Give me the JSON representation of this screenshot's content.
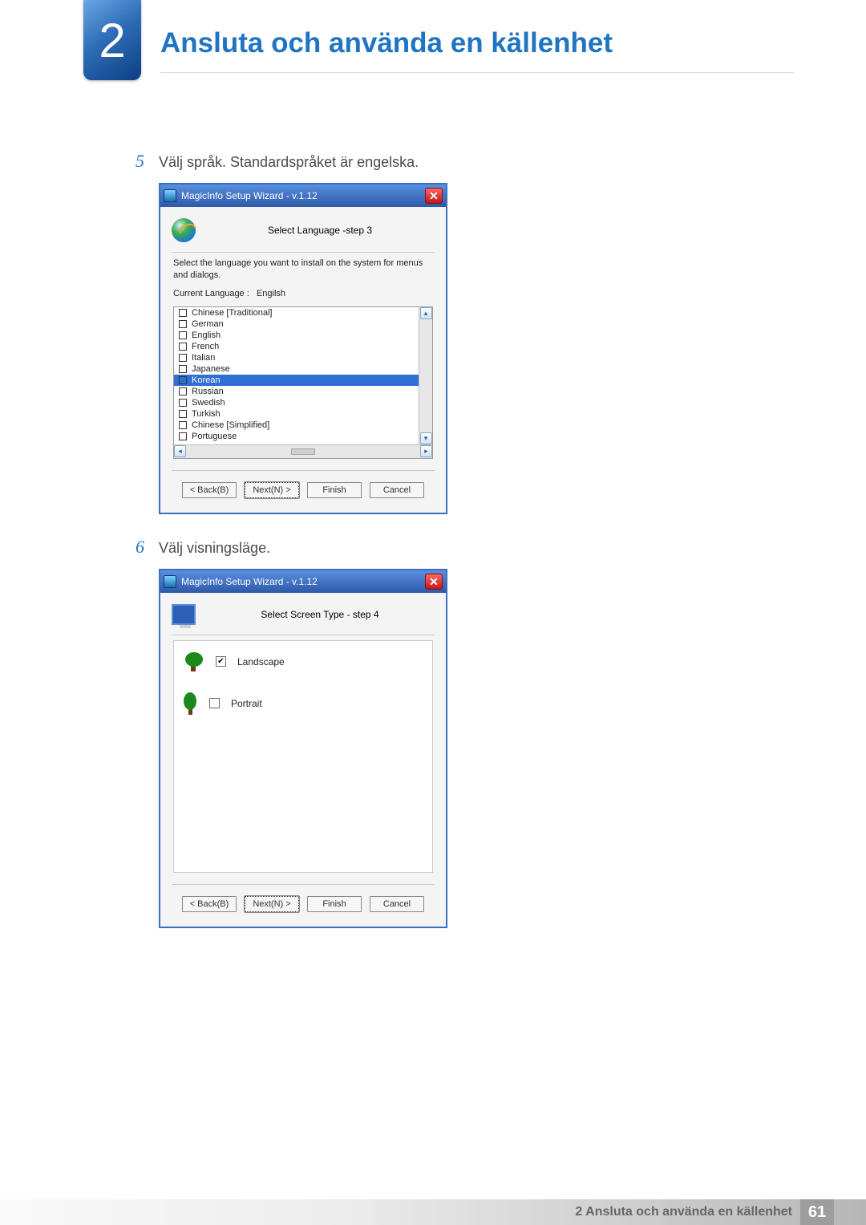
{
  "chapter": {
    "number": "2",
    "title": "Ansluta och använda en källenhet"
  },
  "steps": {
    "s5": {
      "num": "5",
      "text": "Välj språk. Standardspråket är engelska."
    },
    "s6": {
      "num": "6",
      "text": "Välj visningsläge."
    }
  },
  "dialog1": {
    "title": "MagicInfo Setup Wizard - v.1.12",
    "panel_title": "Select Language -step 3",
    "instruction": "Select the language you want to install on the system for menus and dialogs.",
    "current_lang_label": "Current Language    :",
    "current_lang_value": "Engilsh",
    "languages": [
      "Chinese [Traditional]",
      "German",
      "English",
      "French",
      "Italian",
      "Japanese",
      "Korean",
      "Russian",
      "Swedish",
      "Turkish",
      "Chinese [Simplified]",
      "Portuguese"
    ],
    "selected_index": 6,
    "buttons": {
      "back": "< Back(B)",
      "next": "Next(N) >",
      "finish": "Finish",
      "cancel": "Cancel"
    }
  },
  "dialog2": {
    "title": "MagicInfo Setup Wizard - v.1.12",
    "panel_title": "Select Screen Type - step 4",
    "options": {
      "landscape": "Landscape",
      "portrait": "Portrait"
    },
    "checked": "landscape",
    "buttons": {
      "back": "< Back(B)",
      "next": "Next(N) >",
      "finish": "Finish",
      "cancel": "Cancel"
    }
  },
  "footer": {
    "text": "2 Ansluta och använda en källenhet",
    "page": "61"
  }
}
